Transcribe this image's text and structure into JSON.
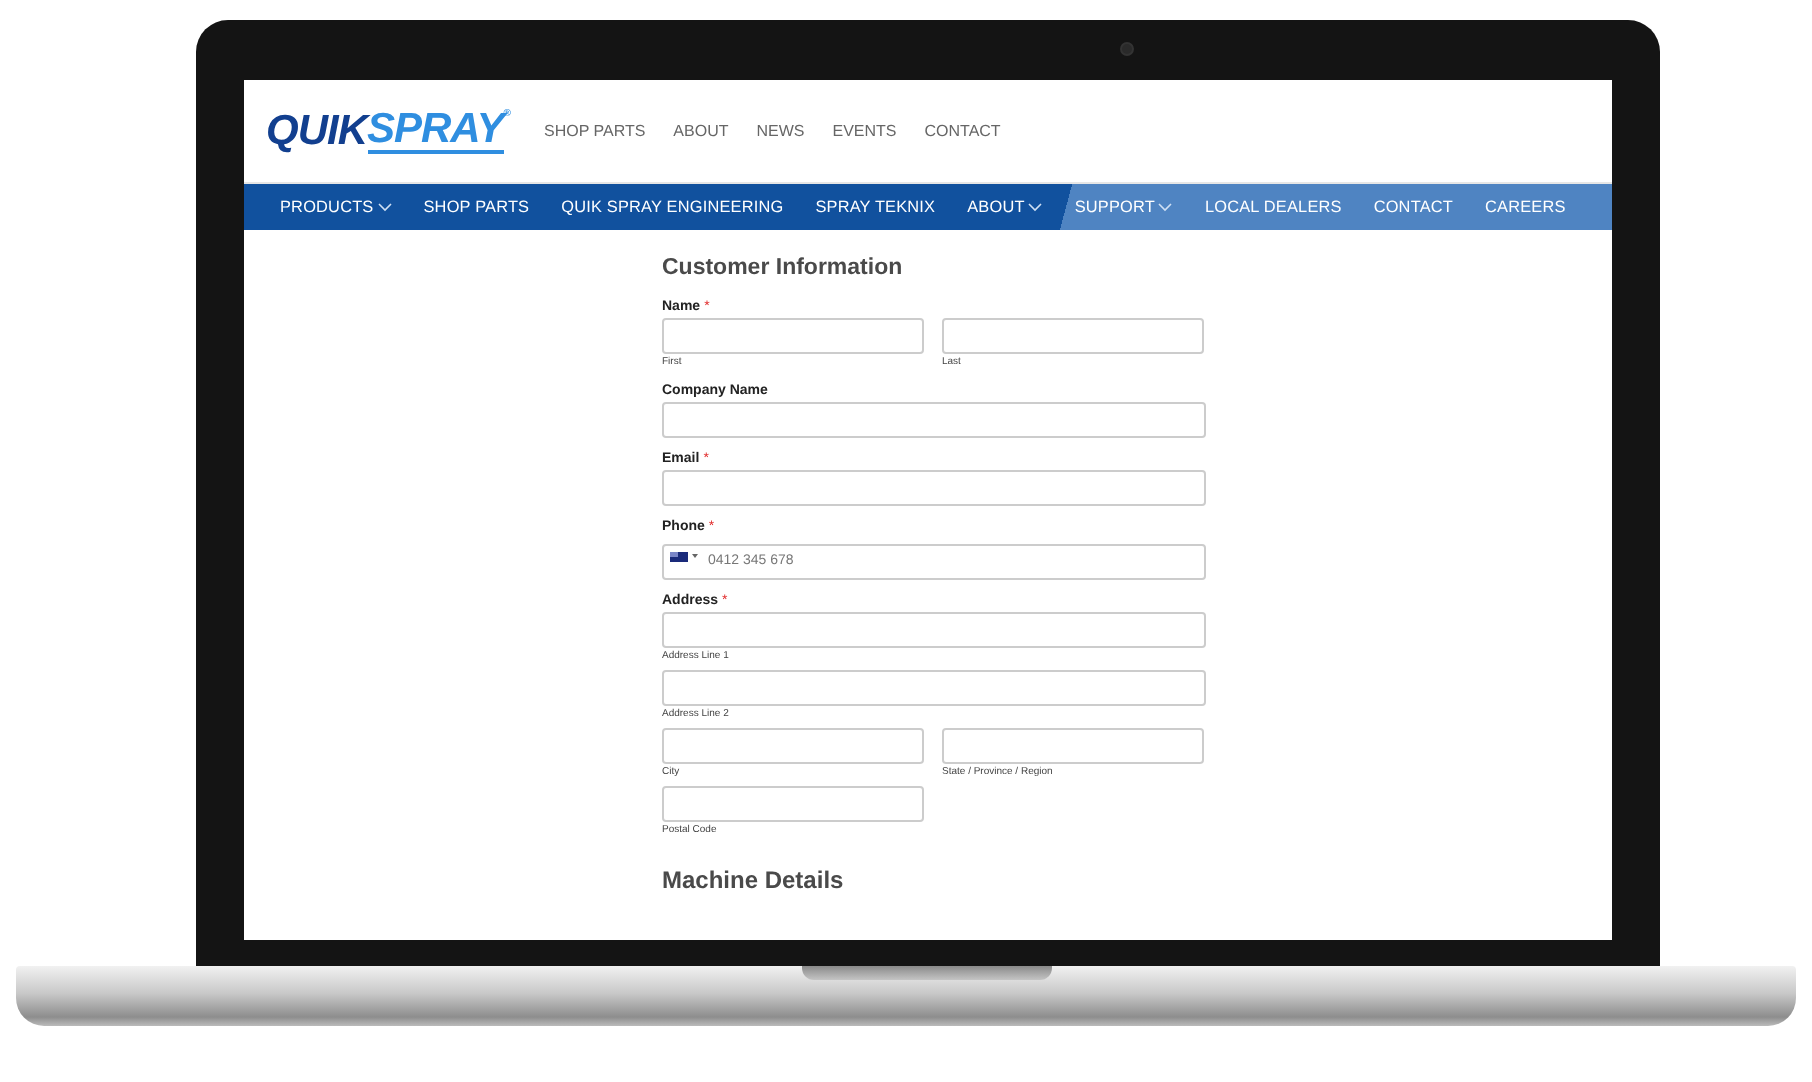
{
  "logo": {
    "part_1": "QUIK",
    "part_2": "SPRAY",
    "mark": "®"
  },
  "top_links": [
    "SHOP PARTS",
    "ABOUT",
    "NEWS",
    "EVENTS",
    "CONTACT"
  ],
  "nav": [
    {
      "label": "PRODUCTS",
      "has_menu": true
    },
    {
      "label": "SHOP PARTS",
      "has_menu": false
    },
    {
      "label": "QUIK SPRAY ENGINEERING",
      "has_menu": false
    },
    {
      "label": "SPRAY TEKNIX",
      "has_menu": false
    },
    {
      "label": "ABOUT",
      "has_menu": true
    },
    {
      "label": "SUPPORT",
      "has_menu": true
    },
    {
      "label": "LOCAL DEALERS",
      "has_menu": false
    },
    {
      "label": "CONTACT",
      "has_menu": false
    },
    {
      "label": "CAREERS",
      "has_menu": false
    }
  ],
  "form": {
    "title": "Customer Information",
    "groups": [
      {
        "label": "Name",
        "required_mark": "*",
        "rows": [
          [
            {
              "kind": "half",
              "sublabel": "First"
            },
            {
              "kind": "half",
              "sublabel": "Last"
            }
          ]
        ]
      },
      {
        "label": "Company Name",
        "rows": [
          [
            {
              "kind": "full"
            }
          ]
        ]
      },
      {
        "label": "Email",
        "required_mark": "*",
        "rows": [
          [
            {
              "kind": "full"
            }
          ]
        ]
      },
      {
        "label": "Phone",
        "required_mark": "*",
        "rows": [
          [
            {
              "kind": "phone",
              "placeholder": "0412 345 678"
            }
          ]
        ]
      },
      {
        "label": "Address",
        "required_mark": "*",
        "rows": [
          [
            {
              "kind": "full",
              "sublabel": "Address Line 1"
            }
          ],
          [
            {
              "kind": "full",
              "sublabel": "Address Line 2"
            }
          ],
          [
            {
              "kind": "half",
              "sublabel": "City"
            },
            {
              "kind": "half",
              "sublabel": "State / Province / Region"
            }
          ],
          [
            {
              "kind": "half",
              "sublabel": "Postal Code"
            }
          ]
        ]
      }
    ],
    "next_heading": "Machine Details"
  }
}
